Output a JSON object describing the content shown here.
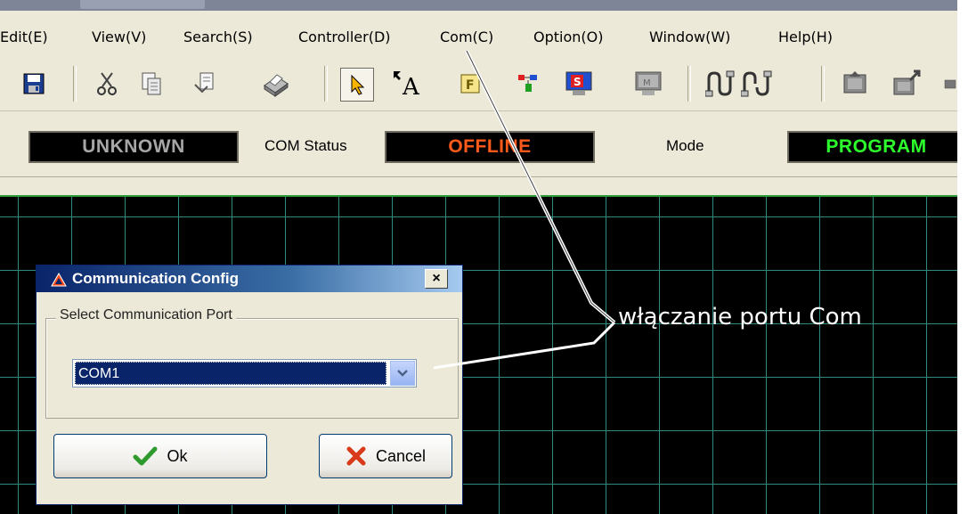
{
  "menu": {
    "items": [
      {
        "label": "Edit(E)"
      },
      {
        "label": "View(V)"
      },
      {
        "label": "Search(S)"
      },
      {
        "label": "Controller(D)"
      },
      {
        "label": "Com(C)"
      },
      {
        "label": "Option(O)"
      },
      {
        "label": "Window(W)"
      },
      {
        "label": "Help(H)"
      }
    ]
  },
  "toolbar": {
    "buttons": [
      "save-icon",
      "cut-icon",
      "copy-icon",
      "paste-icon",
      "print-icon",
      "select-pointer-icon",
      "text-tool-icon",
      "frame-icon",
      "ladder-icon",
      "simulation-icon",
      "monitor-icon",
      "connect-icon",
      "disconnect-icon",
      "upload-icon",
      "download-icon"
    ]
  },
  "status": {
    "plc": "UNKNOWN",
    "com_label": "COM Status",
    "com_value": "OFFLINE",
    "mode_label": "Mode",
    "mode_value": "PROGRAM",
    "colors": {
      "plc": "#a6a6a6",
      "com": "#ff5a1a",
      "mode": "#2cff2c"
    }
  },
  "dialog": {
    "title": "Communication Config",
    "group_label": "Select Communication Port",
    "port_value": "COM1",
    "ok_label": "Ok",
    "cancel_label": "Cancel",
    "close_glyph": "×"
  },
  "annotation": {
    "text": "włączanie portu Com"
  }
}
